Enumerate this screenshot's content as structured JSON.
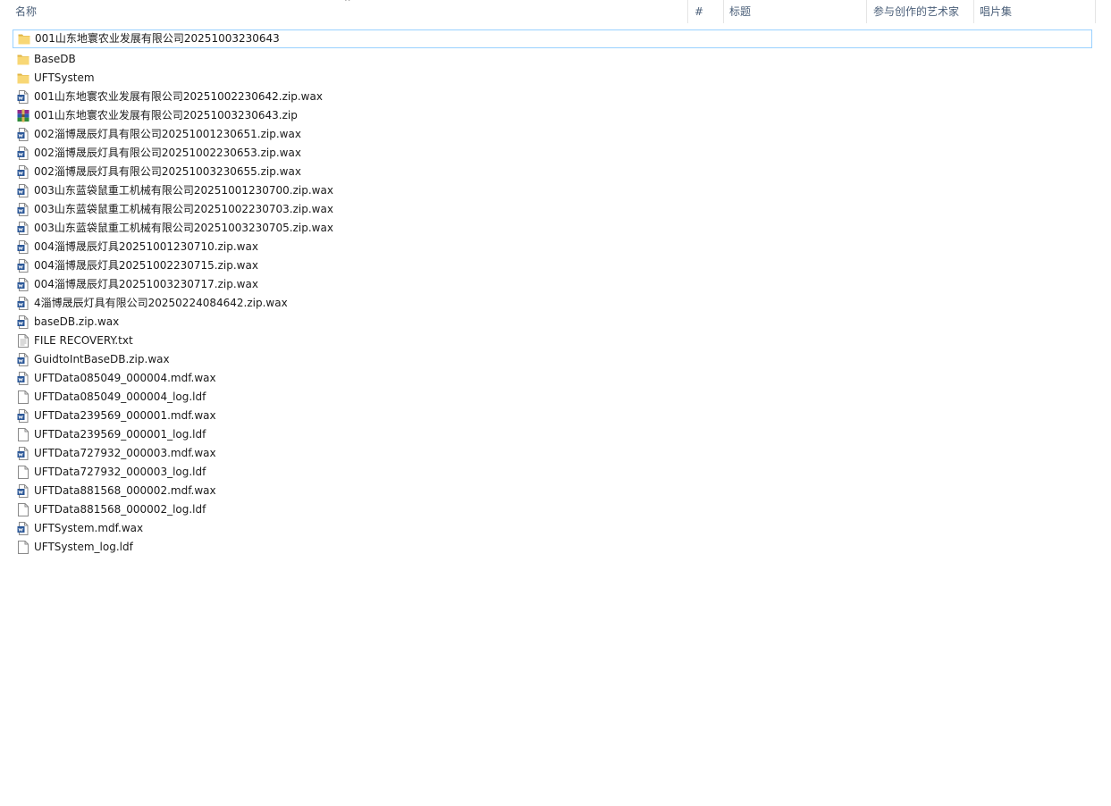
{
  "header": {
    "columns": [
      {
        "label": "名称"
      },
      {
        "label": "#"
      },
      {
        "label": "标题"
      },
      {
        "label": "参与创作的艺术家"
      },
      {
        "label": "唱片集"
      }
    ],
    "sort_indicator": "^"
  },
  "files": [
    {
      "name": "001山东地寰农业发展有限公司20251003230643",
      "icon": "folder-icon",
      "selected": true
    },
    {
      "name": "BaseDB",
      "icon": "folder-icon"
    },
    {
      "name": "UFTSystem",
      "icon": "folder-icon"
    },
    {
      "name": "001山东地寰农业发展有限公司20251002230642.zip.wax",
      "icon": "wax-file-icon"
    },
    {
      "name": "001山东地寰农业发展有限公司20251003230643.zip",
      "icon": "zip-archive-icon"
    },
    {
      "name": "002淄博晟辰灯具有限公司20251001230651.zip.wax",
      "icon": "wax-file-icon"
    },
    {
      "name": "002淄博晟辰灯具有限公司20251002230653.zip.wax",
      "icon": "wax-file-icon"
    },
    {
      "name": "002淄博晟辰灯具有限公司20251003230655.zip.wax",
      "icon": "wax-file-icon"
    },
    {
      "name": "003山东蓝袋鼠重工机械有限公司20251001230700.zip.wax",
      "icon": "wax-file-icon"
    },
    {
      "name": "003山东蓝袋鼠重工机械有限公司20251002230703.zip.wax",
      "icon": "wax-file-icon"
    },
    {
      "name": "003山东蓝袋鼠重工机械有限公司20251003230705.zip.wax",
      "icon": "wax-file-icon"
    },
    {
      "name": "004淄博晟辰灯具20251001230710.zip.wax",
      "icon": "wax-file-icon"
    },
    {
      "name": "004淄博晟辰灯具20251002230715.zip.wax",
      "icon": "wax-file-icon"
    },
    {
      "name": "004淄博晟辰灯具20251003230717.zip.wax",
      "icon": "wax-file-icon"
    },
    {
      "name": "4淄博晟辰灯具有限公司20250224084642.zip.wax",
      "icon": "wax-file-icon"
    },
    {
      "name": "baseDB.zip.wax",
      "icon": "wax-file-icon"
    },
    {
      "name": "FILE RECOVERY.txt",
      "icon": "text-file-icon"
    },
    {
      "name": "GuidtoIntBaseDB.zip.wax",
      "icon": "wax-file-icon"
    },
    {
      "name": "UFTData085049_000004.mdf.wax",
      "icon": "wax-file-icon"
    },
    {
      "name": "UFTData085049_000004_log.ldf",
      "icon": "blank-file-icon"
    },
    {
      "name": "UFTData239569_000001.mdf.wax",
      "icon": "wax-file-icon"
    },
    {
      "name": "UFTData239569_000001_log.ldf",
      "icon": "blank-file-icon"
    },
    {
      "name": "UFTData727932_000003.mdf.wax",
      "icon": "wax-file-icon"
    },
    {
      "name": "UFTData727932_000003_log.ldf",
      "icon": "blank-file-icon"
    },
    {
      "name": "UFTData881568_000002.mdf.wax",
      "icon": "wax-file-icon"
    },
    {
      "name": "UFTData881568_000002_log.ldf",
      "icon": "blank-file-icon"
    },
    {
      "name": "UFTSystem.mdf.wax",
      "icon": "wax-file-icon"
    },
    {
      "name": "UFTSystem_log.ldf",
      "icon": "blank-file-icon"
    }
  ],
  "colors": {
    "header_text": "#4c607a",
    "selection_border": "#99d1ff",
    "folder": "#f8d775",
    "folder_dark": "#e0b545"
  }
}
